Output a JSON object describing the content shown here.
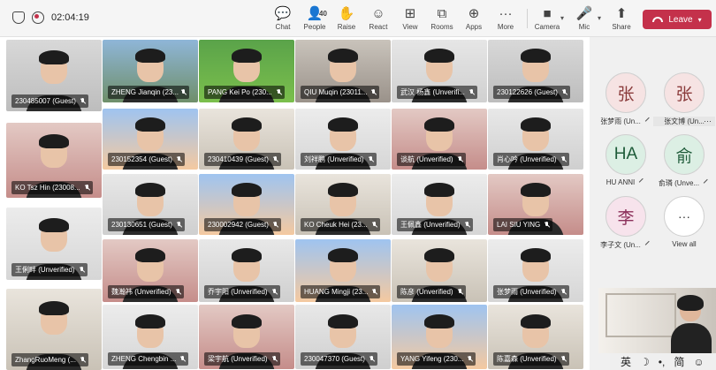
{
  "toolbar": {
    "timer": "02:04:19",
    "people_count": "40",
    "items": [
      {
        "label": "Chat",
        "glyph": "💬"
      },
      {
        "label": "People",
        "glyph": "👤"
      },
      {
        "label": "Raise",
        "glyph": "✋"
      },
      {
        "label": "React",
        "glyph": "☺"
      },
      {
        "label": "View",
        "glyph": "⊞"
      },
      {
        "label": "Rooms",
        "glyph": "⧉"
      },
      {
        "label": "Apps",
        "glyph": "⊕"
      },
      {
        "label": "More",
        "glyph": "···"
      },
      {
        "label": "Camera",
        "glyph": "■"
      },
      {
        "label": "Mic",
        "glyph": "🎤"
      },
      {
        "label": "Share",
        "glyph": "⬆"
      }
    ],
    "leave_label": "Leave",
    "leave_color": "#c4314b"
  },
  "tiles": [
    {
      "name": "230485007 (Guest)"
    },
    {
      "name": "ZHENG Jianqin (23..."
    },
    {
      "name": "PANG Kei Po (230..."
    },
    {
      "name": "QIU Muqin (23011..."
    },
    {
      "name": "武汉 杨鑫 (Unverifi..."
    },
    {
      "name": "230122626 (Guest)"
    },
    {
      "name": "230152354 (Guest)"
    },
    {
      "name": "230410439 (Guest)"
    },
    {
      "name": "刘祥鹏 (Unverified)"
    },
    {
      "name": "谈航 (Unverified)"
    },
    {
      "name": "肖心吟 (Unverified)"
    },
    {
      "name": "KO Tsz Hin (23008..."
    },
    {
      "name": "230130651 (Guest)"
    },
    {
      "name": "230002942 (Guest)"
    },
    {
      "name": "KO Cheuk Hei (23..."
    },
    {
      "name": "王佩鑫 (Unverified)"
    },
    {
      "name": "LAI SIU YING"
    },
    {
      "name": "王俐畔 (Unverified)"
    },
    {
      "name": "魏瀚祎 (Unverified)"
    },
    {
      "name": "乔宇阳 (Unverified)"
    },
    {
      "name": "HUANG Mingji (23..."
    },
    {
      "name": "陈彦 (Unverified)"
    },
    {
      "name": "张梦雨 (Unverified)"
    },
    {
      "name": "ZhangRuoMeng (..."
    },
    {
      "name": "ZHENG Chengbin ..."
    },
    {
      "name": "梁宇航 (Unverified)"
    },
    {
      "name": "230047370 (Guest)"
    },
    {
      "name": "YANG Yifeng (230..."
    },
    {
      "name": "陈嘉森 (Unverified)"
    }
  ],
  "sidebar": {
    "people": [
      {
        "initials": "张",
        "name": "张梦雨 (Un...",
        "bg": "#f6e3e3",
        "fg": "#8a3b3b"
      },
      {
        "initials": "张",
        "name": "张文博 (Un...",
        "bg": "#f6e3e3",
        "fg": "#8a3b3b"
      },
      {
        "initials": "HA",
        "name": "HU ANNI",
        "bg": "#dcefe4",
        "fg": "#1f5c3a"
      },
      {
        "initials": "俞",
        "name": "俞璘 (Unve...",
        "bg": "#dcefe4",
        "fg": "#1f5c3a"
      },
      {
        "initials": "李",
        "name": "李子文 (Un...",
        "bg": "#f7e3ec",
        "fg": "#8b2f5a"
      }
    ],
    "view_all": "View all",
    "view_all_glyph": "···"
  },
  "ime": {
    "items": [
      "英",
      "☽",
      "•,",
      "简",
      "☺"
    ]
  }
}
